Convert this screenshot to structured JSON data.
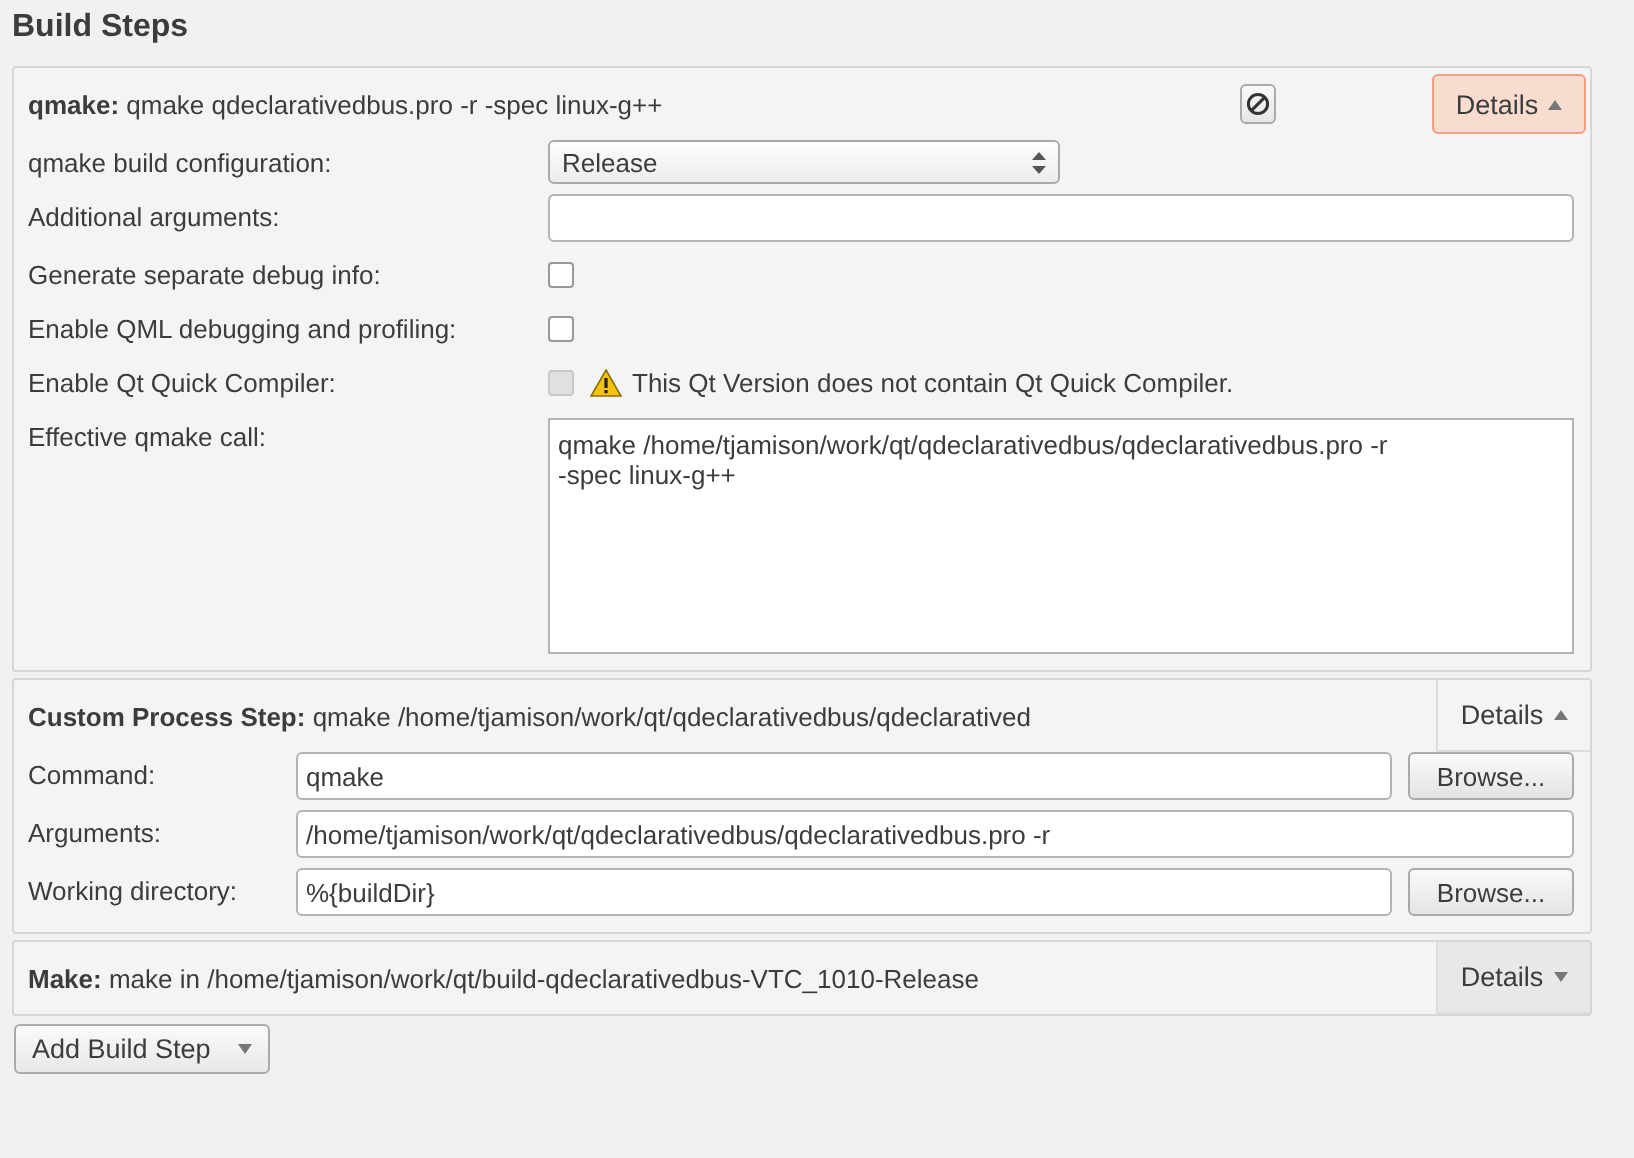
{
  "title": "Build Steps",
  "steps": [
    {
      "kind": "qmake",
      "summary": "**qmake:** qmake qdeclarativedbus.pro -r -spec linux-g++",
      "details": {
        "label": "Details",
        "expanded": true,
        "focused": true
      },
      "rows": [
        {
          "kind": "combo",
          "label": "qmake build configuration:",
          "value": "Release"
        },
        {
          "kind": "text",
          "label": "Additional arguments:"
        },
        {
          "kind": "check",
          "label": "Generate separate debug info:",
          "checked": false,
          "disabled": false
        },
        {
          "kind": "check",
          "label": "Enable QML debugging and profiling:",
          "checked": false,
          "disabled": false
        },
        {
          "kind": "check",
          "label": "Enable Qt Quick Compiler:",
          "checked": false,
          "disabled": true,
          "warning": "This Qt Version does not contain Qt Quick Compiler."
        },
        {
          "kind": "textarea",
          "label": "Effective qmake call:",
          "value": "qmake /home/tjamison/work/qt/qdeclarativedbus/qdeclarativedbus.pro -r\n-spec linux-g++"
        }
      ]
    },
    {
      "kind": "custom",
      "summary": "**Custom Process Step:** qmake /home/tjamison/work/qt/qdeclarativedbus/qdeclaratived",
      "details": {
        "label": "Details",
        "expanded": true,
        "focused": false
      },
      "rows": [
        {
          "kind": "text",
          "label": "Command:",
          "value": "qmake",
          "button": "Browse..."
        },
        {
          "kind": "text",
          "label": "Arguments:",
          "value": "/home/tjamison/work/qt/qdeclarativedbus/qdeclarativedbus.pro -r"
        },
        {
          "kind": "text",
          "label": "Working directory:",
          "value": "%{buildDir}",
          "button": "Browse..."
        }
      ]
    },
    {
      "kind": "make",
      "summary": "**Make:** make in /home/tjamison/work/qt/build-qdeclarativedbus-VTC_1010-Release",
      "details": {
        "label": "Details",
        "expanded": false,
        "focused": false
      }
    }
  ],
  "add_button": "Add Build Step"
}
